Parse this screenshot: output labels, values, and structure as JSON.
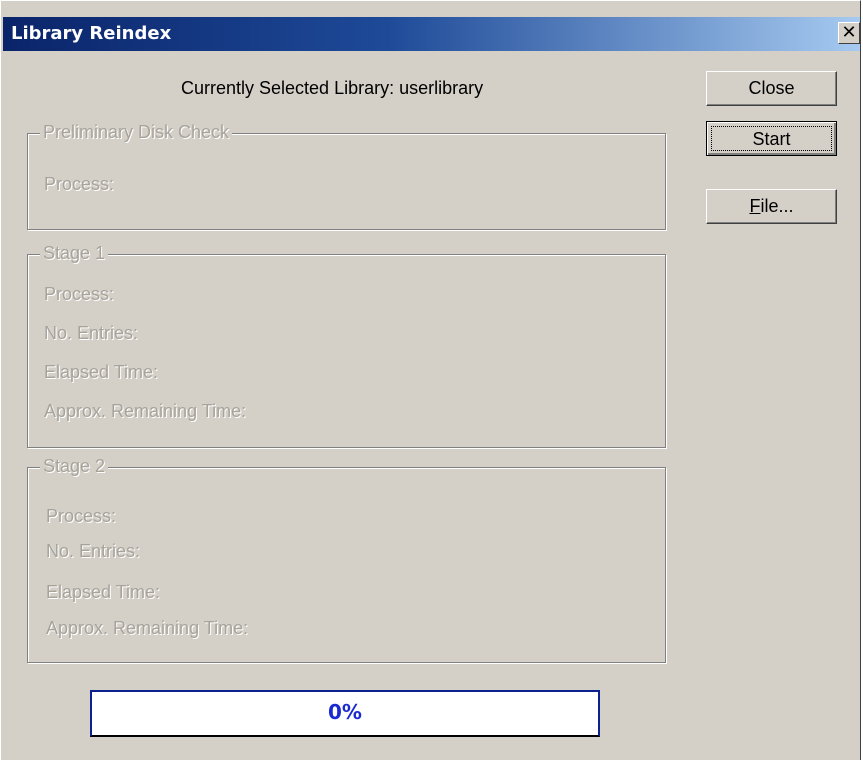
{
  "window": {
    "title": "Library Reindex",
    "close_glyph": "✕"
  },
  "library": {
    "label": "Currently Selected Library: userlibrary"
  },
  "groups": {
    "preliminary": {
      "title": "Preliminary Disk Check",
      "process_label": "Process:"
    },
    "stage1": {
      "title": "Stage 1",
      "process_label": "Process:",
      "entries_label": "No. Entries:",
      "elapsed_label": "Elapsed Time:",
      "remaining_label": "Approx. Remaining Time:"
    },
    "stage2": {
      "title": "Stage 2",
      "process_label": "Process:",
      "entries_label": "No. Entries:",
      "elapsed_label": "Elapsed Time:",
      "remaining_label": "Approx. Remaining Time:"
    }
  },
  "buttons": {
    "close_label": "Close",
    "start_label": "Start",
    "file_mnemonic": "F",
    "file_rest": "ile..."
  },
  "progress": {
    "percent_text": "0%",
    "fraction": 0
  },
  "colors": {
    "title_bar": "#0a246a",
    "dialog_face": "#d4d0c8",
    "disabled_text": "#a6a39b",
    "progress_text": "#1a2ad0"
  },
  "icons": {
    "close": "close-icon"
  }
}
